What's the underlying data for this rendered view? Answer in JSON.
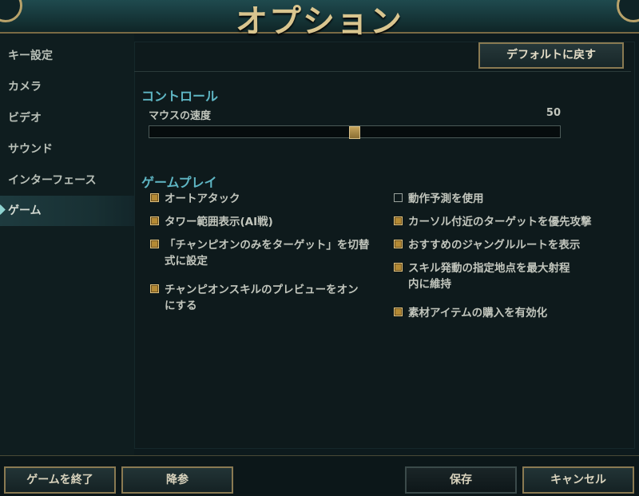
{
  "header": {
    "title": "オプション"
  },
  "sidebar": {
    "items": [
      {
        "label": "キー設定",
        "active": false
      },
      {
        "label": "カメラ",
        "active": false
      },
      {
        "label": "ビデオ",
        "active": false
      },
      {
        "label": "サウンド",
        "active": false
      },
      {
        "label": "インターフェース",
        "active": false
      },
      {
        "label": "ゲーム",
        "active": true
      }
    ]
  },
  "main": {
    "default_button": "デフォルトに戻す",
    "control_section": {
      "title": "コントロール",
      "mouse_speed_label": "マウスの速度",
      "mouse_speed_value": "50",
      "mouse_speed_fraction": 0.5
    },
    "gameplay_section": {
      "title": "ゲームプレイ",
      "left_options": [
        {
          "label": "オートアタック",
          "checked": true
        },
        {
          "label": "タワー範囲表示(AI戦)",
          "checked": true
        },
        {
          "label_line1": "「チャンピオンのみをターゲット」を切替",
          "label_line2": "式に設定",
          "checked": true
        },
        {
          "label_line1": "チャンピオンスキルのプレビューをオン",
          "label_line2": "にする",
          "checked": true
        }
      ],
      "right_options": [
        {
          "label": "動作予測を使用",
          "checked": false
        },
        {
          "label": "カーソル付近のターゲットを優先攻撃",
          "checked": true
        },
        {
          "label": "おすすめのジャングルルートを表示",
          "checked": true
        },
        {
          "label_line1": "スキル発動の指定地点を最大射程",
          "label_line2": "内に維持",
          "checked": true
        },
        {
          "label": "素材アイテムの購入を有効化",
          "checked": true
        }
      ]
    }
  },
  "footer": {
    "quit_game": "ゲームを終了",
    "surrender": "降参",
    "save": "保存",
    "cancel": "キャンセル"
  },
  "colors": {
    "accent_gold": "#b48a34",
    "section_teal": "#5fb6c4",
    "title_gold": "#d9c58f"
  }
}
